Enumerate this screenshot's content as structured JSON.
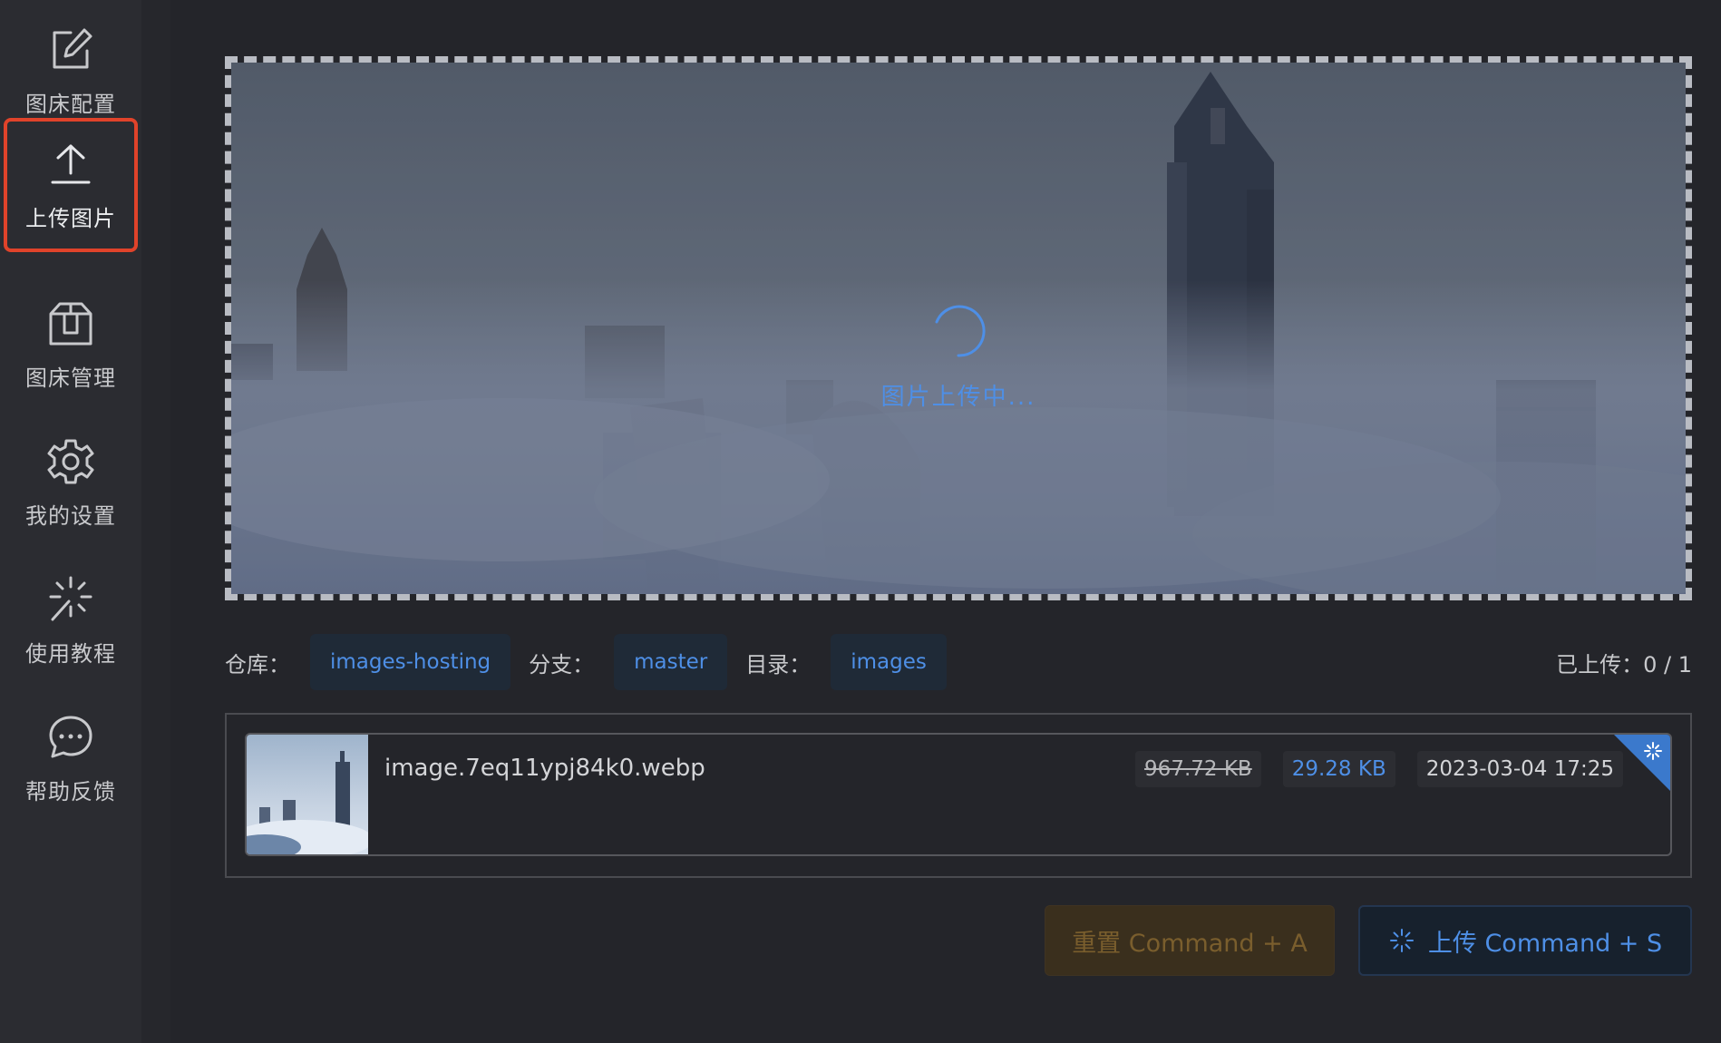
{
  "sidebar": {
    "items": [
      {
        "label": "图床配置",
        "icon": "edit-icon",
        "active": false
      },
      {
        "label": "上传图片",
        "icon": "upload-icon",
        "active": true
      },
      {
        "label": "图床管理",
        "icon": "box-icon",
        "active": false
      },
      {
        "label": "我的设置",
        "icon": "gear-icon",
        "active": false
      },
      {
        "label": "使用教程",
        "icon": "sparkle-icon",
        "active": false
      },
      {
        "label": "帮助反馈",
        "icon": "chat-icon",
        "active": false
      }
    ]
  },
  "upload_area": {
    "loading_text": "图片上传中..."
  },
  "repo_info": {
    "repo_label": "仓库：",
    "repo_value": "images-hosting",
    "branch_label": "分支：",
    "branch_value": "master",
    "dir_label": "目录：",
    "dir_value": "images",
    "uploaded_label": "已上传：",
    "uploaded_count": "0 / 1"
  },
  "file_list": [
    {
      "filename": "image.7eq11ypj84k0.webp",
      "original_size": "967.72 KB",
      "compressed_size": "29.28 KB",
      "date": "2023-03-04 17:25"
    }
  ],
  "buttons": {
    "reset": "重置 Command + A",
    "upload": "上传 Command + S"
  },
  "colors": {
    "accent": "#4e8fe6",
    "active_border": "#e0432a",
    "background": "#24252a",
    "sidebar": "#2b2c31",
    "reset_text": "#7a5e2d"
  }
}
